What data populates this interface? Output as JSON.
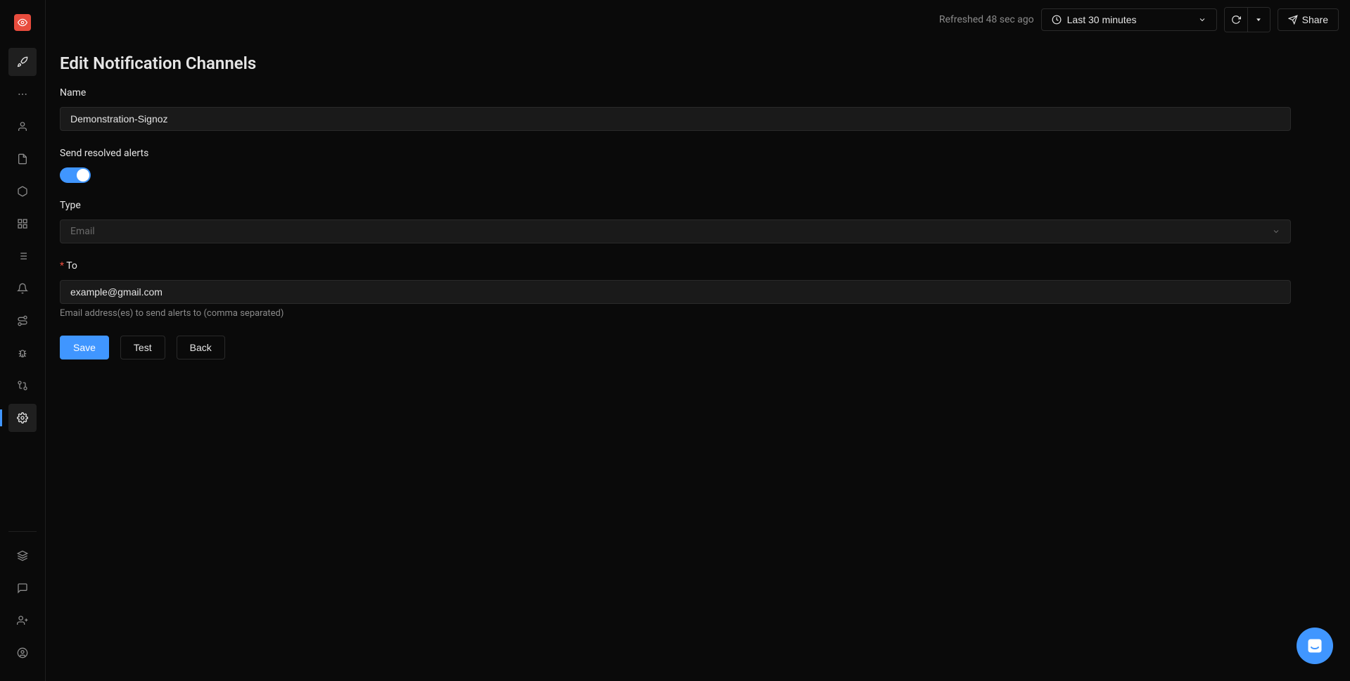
{
  "header": {
    "refreshed_text": "Refreshed 48 sec ago",
    "time_range_label": "Last 30 minutes",
    "share_label": "Share"
  },
  "page": {
    "title": "Edit Notification Channels"
  },
  "form": {
    "name": {
      "label": "Name",
      "value": "Demonstration-Signoz"
    },
    "resolved_alerts": {
      "label": "Send resolved alerts",
      "enabled": true
    },
    "type": {
      "label": "Type",
      "value": "Email"
    },
    "to": {
      "label": "To",
      "value": "example@gmail.com",
      "help_text": "Email address(es) to send alerts to (comma separated)"
    }
  },
  "buttons": {
    "save": "Save",
    "test": "Test",
    "back": "Back"
  },
  "sidebar": {
    "logo_name": "logo",
    "items": [
      {
        "name": "rocket-icon",
        "semantic": "sidebar-item-getting-started"
      },
      {
        "name": "ellipsis-icon",
        "semantic": "sidebar-item-more"
      },
      {
        "name": "user-icon",
        "semantic": "sidebar-item-user"
      },
      {
        "name": "document-icon",
        "semantic": "sidebar-item-logs"
      },
      {
        "name": "cube-icon",
        "semantic": "sidebar-item-services"
      },
      {
        "name": "grid-icon",
        "semantic": "sidebar-item-dashboards"
      },
      {
        "name": "list-icon",
        "semantic": "sidebar-item-traces"
      },
      {
        "name": "bell-icon",
        "semantic": "sidebar-item-alerts"
      },
      {
        "name": "route-icon",
        "semantic": "sidebar-item-exceptions"
      },
      {
        "name": "bug-icon",
        "semantic": "sidebar-item-bugs"
      },
      {
        "name": "workflow-icon",
        "semantic": "sidebar-item-workflow"
      },
      {
        "name": "gear-icon",
        "semantic": "sidebar-item-settings"
      }
    ],
    "bottom_items": [
      {
        "name": "layers-icon",
        "semantic": "sidebar-item-layers"
      },
      {
        "name": "chat-icon",
        "semantic": "sidebar-item-support"
      },
      {
        "name": "invite-icon",
        "semantic": "sidebar-item-invite"
      },
      {
        "name": "profile-icon",
        "semantic": "sidebar-item-profile"
      }
    ]
  }
}
